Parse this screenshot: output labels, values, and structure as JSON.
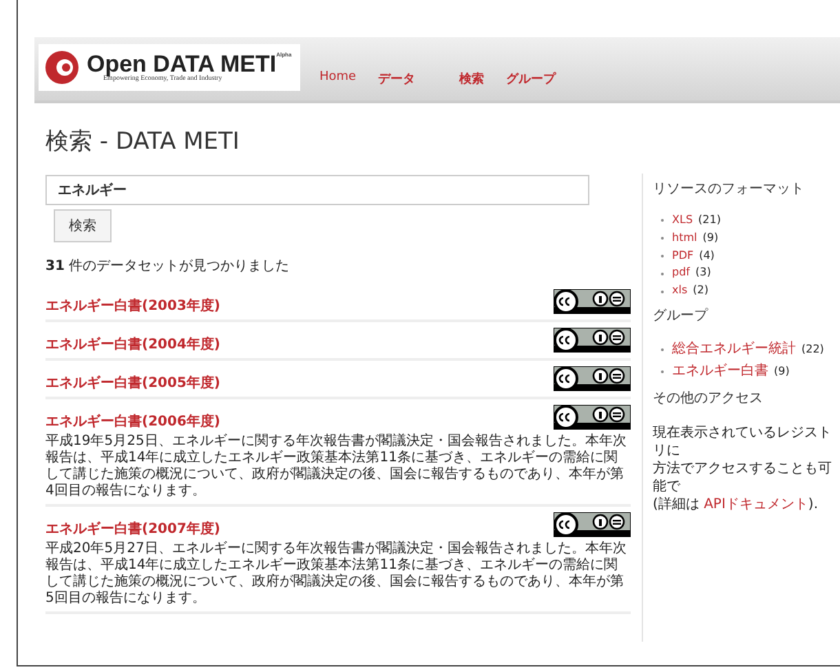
{
  "header": {
    "logo": {
      "title": "Open DATA METI",
      "badge": "Alpha",
      "tagline": "Empowering Economy, Trade and Industry"
    },
    "nav": [
      {
        "label": "Home"
      },
      {
        "label": "データ"
      },
      {
        "label": "検索"
      },
      {
        "label": "グループ"
      }
    ]
  },
  "page_title": "検索 - DATA METI",
  "search": {
    "value": "エネルギー",
    "button": "検索"
  },
  "result_count": {
    "number": "31",
    "text": "件のデータセットが見つかりました"
  },
  "results": [
    {
      "title": "エネルギー白書(2003年度)"
    },
    {
      "title": "エネルギー白書(2004年度)"
    },
    {
      "title": "エネルギー白書(2005年度)"
    },
    {
      "title": "エネルギー白書(2006年度)",
      "description": "平成19年5月25日、エネルギーに関する年次報告書が閣議決定・国会報告されました。本年次報告は、平成14年に成立したエネルギー政策基本法第11条に基づき、エネルギーの需給に関して講じた施策の概況について、政府が閣議決定の後、国会に報告するものであり、本年が第4回目の報告になります。"
    },
    {
      "title": "エネルギー白書(2007年度)",
      "description": "平成20年5月27日、エネルギーに関する年次報告書が閣議決定・国会報告されました。本年次報告は、平成14年に成立したエネルギー政策基本法第11条に基づき、エネルギーの需給に関して講じた施策の概況について、政府が閣議決定の後、国会に報告するものであり、本年が第 5回目の報告になります。"
    }
  ],
  "sidebar": {
    "formats": {
      "heading": "リソースのフォーマット",
      "items": [
        {
          "label": "XLS",
          "count": "(21)"
        },
        {
          "label": "html",
          "count": "(9)"
        },
        {
          "label": "PDF",
          "count": "(4)"
        },
        {
          "label": "pdf",
          "count": "(3)"
        },
        {
          "label": "xls",
          "count": "(2)"
        }
      ]
    },
    "groups": {
      "heading": "グループ",
      "items": [
        {
          "label": "総合エネルギー統計",
          "count": "(22)"
        },
        {
          "label": "エネルギー白書",
          "count": "(9)"
        }
      ]
    },
    "access": {
      "heading": "その他のアクセス",
      "lines": [
        "現在表示されているレジストリに",
        "方法でアクセスすることも可能で"
      ],
      "last_line": {
        "before": "(詳細は ",
        "link": "APIドキュメント",
        "after": ")."
      }
    }
  }
}
